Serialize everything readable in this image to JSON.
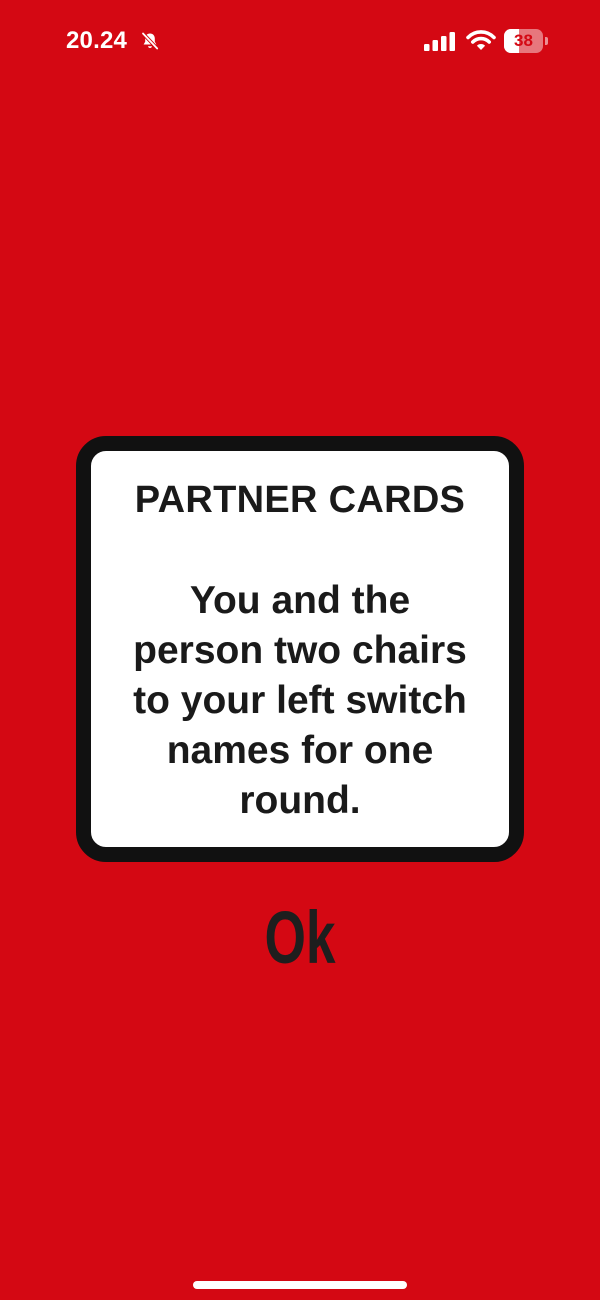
{
  "status_bar": {
    "time": "20.24",
    "battery_level": "38",
    "battery_fraction": 0.38,
    "icons": [
      "bell-slash-icon",
      "cellular-signal-icon",
      "wifi-icon",
      "battery-icon"
    ]
  },
  "card": {
    "title": "PARTNER CARDS",
    "lines": [
      "You and the",
      "person two chairs",
      "to your left switch",
      "names for one",
      "round."
    ]
  },
  "ok_button": {
    "label": "Ok"
  },
  "colors": {
    "background": "#d40813",
    "card_background": "#ffffff",
    "card_border": "#111111",
    "text": "#1a1a1a"
  }
}
